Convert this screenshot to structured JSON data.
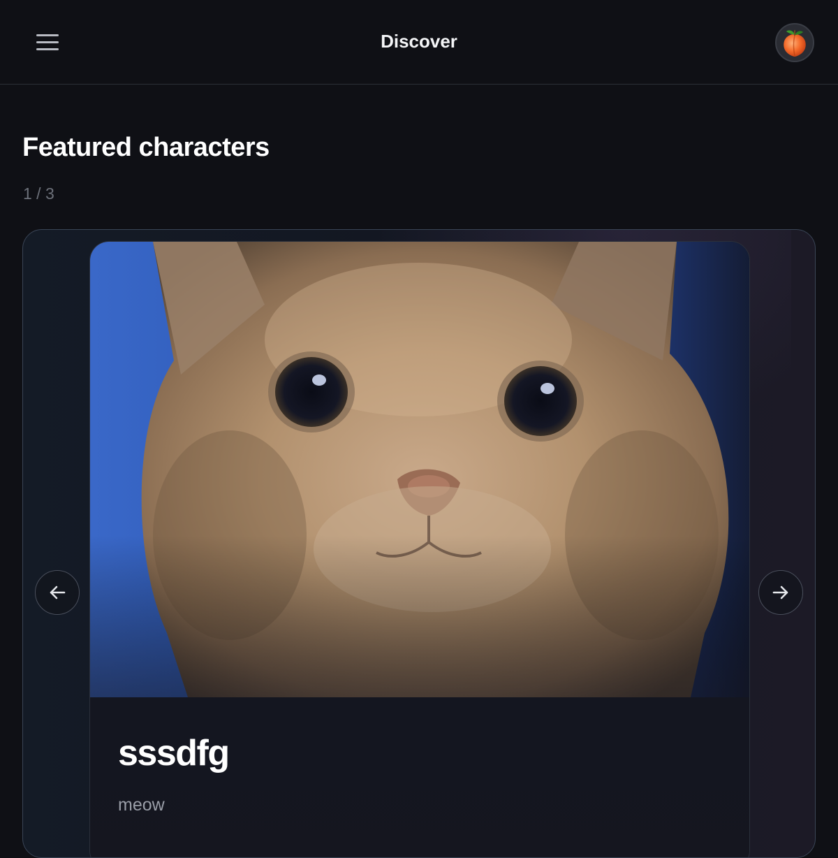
{
  "header": {
    "title": "Discover",
    "menu_icon": "hamburger-menu-icon",
    "avatar_icon": "peach-avatar-icon"
  },
  "featured": {
    "title": "Featured characters",
    "counter": "1 / 3",
    "card": {
      "name": "sssdfg",
      "description": "meow",
      "image_subject": "orange-tabby-cat-closeup"
    },
    "prev_icon": "arrow-left-icon",
    "next_icon": "arrow-right-icon"
  },
  "colors": {
    "background": "#0f1015",
    "accent_border": "#3a4556",
    "muted_text": "#6d717a"
  }
}
